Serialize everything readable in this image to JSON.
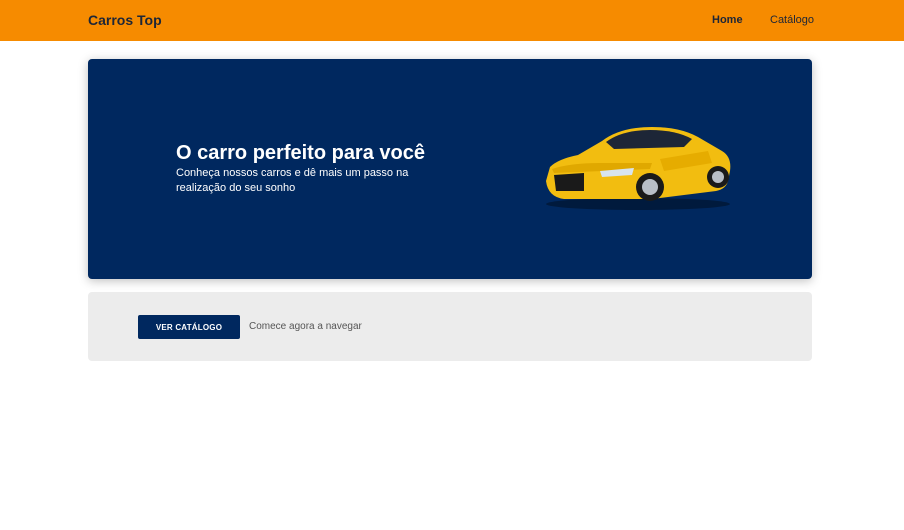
{
  "navbar": {
    "brand": "Carros Top",
    "links": [
      {
        "label": "Home",
        "active": true
      },
      {
        "label": "Catálogo",
        "active": false
      }
    ],
    "background_color": "#f68b00"
  },
  "hero": {
    "title": "O carro perfeito para você",
    "subtitle": "Conheça nossos carros e dê mais um passo na realização do seu sonho",
    "image": "yellow-sports-car",
    "background_color": "#00285f"
  },
  "cta": {
    "button_label": "VER CATÁLOGO",
    "text": "Comece agora a navegar",
    "background_color": "#ececec"
  }
}
